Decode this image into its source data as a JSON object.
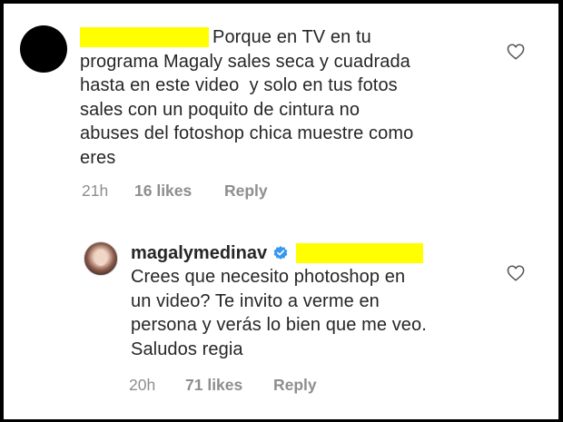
{
  "comment": {
    "text_lines": [
      "Porque en TV en tu",
      "programa Magaly sales seca y cuadrada",
      "hasta en este video  y solo en tus fotos",
      "sales con un poquito de cintura no",
      "abuses del fotoshop chica muestre como",
      "eres"
    ],
    "time": "21h",
    "likes": "16 likes",
    "reply_label": "Reply"
  },
  "reply": {
    "username": "magalymedinav",
    "text_lines": [
      "Crees que necesito photoshop en",
      "un video? Te invito a verme en",
      "persona y verás lo bien que me veo.",
      "Saludos regia"
    ],
    "time": "20h",
    "likes": "71 likes",
    "reply_label": "Reply"
  },
  "colors": {
    "redaction": "#ffff00",
    "verified": "#3897f0",
    "meta_text": "#8e8e8e",
    "text": "#262626"
  },
  "icons": {
    "like": "heart-outline-icon",
    "verified": "verified-badge-icon"
  }
}
